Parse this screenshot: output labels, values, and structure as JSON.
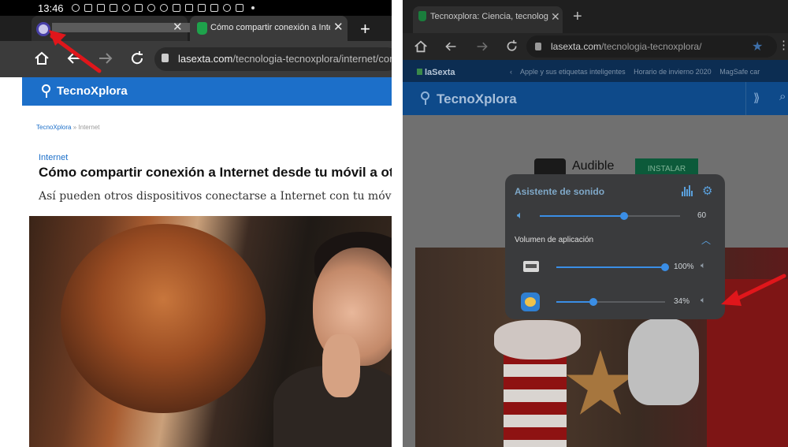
{
  "left": {
    "status_time": "13:46",
    "tabs": [
      {
        "title": "",
        "close": "✕"
      },
      {
        "title": "Cómo compartir conexión a Inte",
        "close": "✕"
      }
    ],
    "new_tab": "+",
    "url_domain": "lasexta.com",
    "url_path": "/tecnologia-tecnoxplora/internet/com",
    "site_logo": "TecnoXplora",
    "breadcrumb_home": "TecnoXplora",
    "breadcrumb_sep": "» Internet",
    "section": "Internet",
    "headline": "Cómo compartir conexión a Internet desde tu móvil a otros",
    "subtitle": "Así pueden otros dispositivos conectarse a Internet con tu móvil"
  },
  "right": {
    "tab_title": "Tecnoxplora: Ciencia, tecnología",
    "tab_close": "✕",
    "new_tab": "+",
    "url_domain": "lasexta.com",
    "url_path": "/tecnologia-tecnoxplora/",
    "network_logo": "laSexta",
    "top_links": [
      "Apple y sus etiquetas inteligentes",
      "Horario de invierno 2020",
      "MagSafe car"
    ],
    "site_logo": "TecnoXplora",
    "ad_title": "Audible",
    "ad_button": "INSTALAR",
    "sound": {
      "title": "Asistente de sonido",
      "master_volume": 60,
      "master_label": "60",
      "app_section_label": "Volumen de aplicación",
      "apps": [
        {
          "volume": 100,
          "label": "100%"
        },
        {
          "volume": 34,
          "label": "34%"
        }
      ]
    }
  },
  "colors": {
    "annotation_arrow": "#e0161b",
    "site_blue": "#1c6fc9",
    "slider_blue": "#3a8ee6"
  },
  "icons": {
    "home": "home-icon",
    "back": "back-arrow-icon",
    "forward": "forward-arrow-icon",
    "reload": "reload-icon",
    "lock": "lock-icon",
    "star": "bookmark-star-icon",
    "speaker": "speaker-icon",
    "equalizer": "equalizer-icon",
    "gear": "gear-icon",
    "chevron": "chevron-up-icon"
  }
}
